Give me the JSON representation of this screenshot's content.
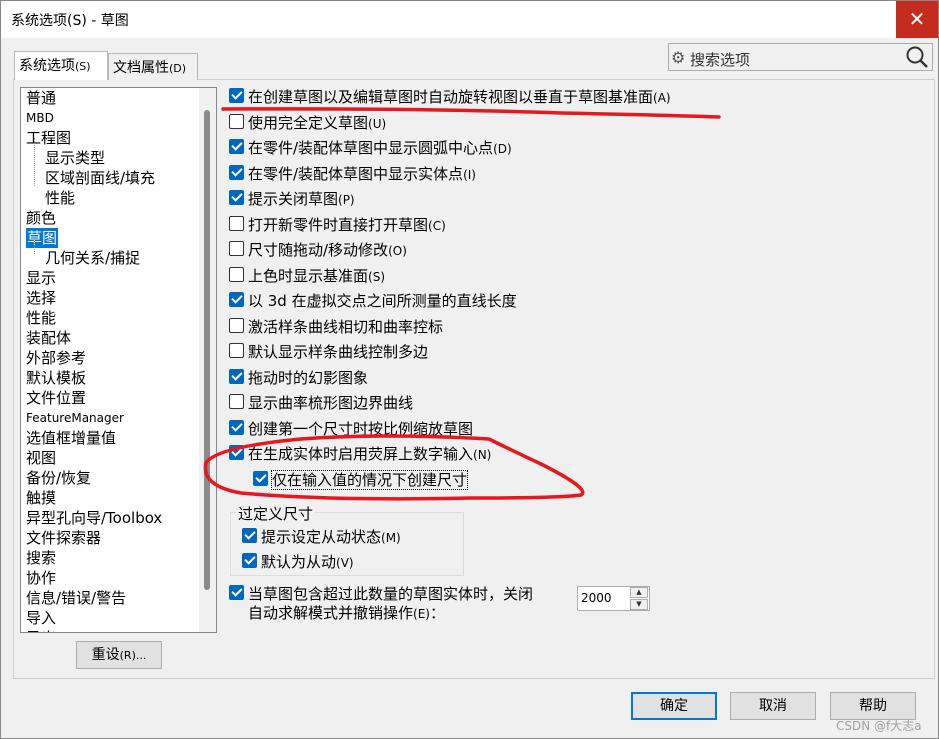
{
  "window": {
    "title": "系统选项(S) - 草图",
    "close": "✕"
  },
  "tabs": [
    {
      "label": "系统选项",
      "hotkey": "(S)"
    },
    {
      "label": "文档属性",
      "hotkey": "(D)"
    }
  ],
  "search": {
    "placeholder": "搜索选项"
  },
  "tree": [
    {
      "label": "普通"
    },
    {
      "label": "MBD"
    },
    {
      "label": "工程图"
    },
    {
      "label": "显示类型"
    },
    {
      "label": "区域剖面线/填充"
    },
    {
      "label": "性能"
    },
    {
      "label": "颜色"
    },
    {
      "label": "草图"
    },
    {
      "label": "几何关系/捕捉"
    },
    {
      "label": "显示"
    },
    {
      "label": "选择"
    },
    {
      "label": "性能"
    },
    {
      "label": "装配体"
    },
    {
      "label": "外部参考"
    },
    {
      "label": "默认模板"
    },
    {
      "label": "文件位置"
    },
    {
      "label": "FeatureManager"
    },
    {
      "label": "选值框增量值"
    },
    {
      "label": "视图"
    },
    {
      "label": "备份/恢复"
    },
    {
      "label": "触摸"
    },
    {
      "label": "异型孔向导/Toolbox"
    },
    {
      "label": "文件探索器"
    },
    {
      "label": "搜索"
    },
    {
      "label": "协作"
    },
    {
      "label": "信息/错误/警告"
    },
    {
      "label": "导入"
    },
    {
      "label": "导出"
    }
  ],
  "options": [
    {
      "label": "在创建草图以及编辑草图时自动旋转视图以垂直于草图基准面",
      "hotkey": "(A)",
      "checked": true
    },
    {
      "label": "使用完全定义草图",
      "hotkey": "(U)",
      "checked": false
    },
    {
      "label": "在零件/装配体草图中显示圆弧中心点",
      "hotkey": "(D)",
      "checked": true
    },
    {
      "label": "在零件/装配体草图中显示实体点",
      "hotkey": "(I)",
      "checked": true
    },
    {
      "label": "提示关闭草图",
      "hotkey": "(P)",
      "checked": true
    },
    {
      "label": "打开新零件时直接打开草图",
      "hotkey": "(C)",
      "checked": false
    },
    {
      "label": "尺寸随拖动/移动修改",
      "hotkey": "(O)",
      "checked": false
    },
    {
      "label": "上色时显示基准面",
      "hotkey": "(S)",
      "checked": false
    },
    {
      "label": "以 3d 在虚拟交点之间所测量的直线长度",
      "hotkey": "",
      "checked": true
    },
    {
      "label": "激活样条曲线相切和曲率控标",
      "hotkey": "",
      "checked": false
    },
    {
      "label": "默认显示样条曲线控制多边",
      "hotkey": "",
      "checked": false
    },
    {
      "label": "拖动时的幻影图象",
      "hotkey": "",
      "checked": true
    },
    {
      "label": "显示曲率梳形图边界曲线",
      "hotkey": "",
      "checked": false
    },
    {
      "label": "创建第一个尺寸时按比例缩放草图",
      "hotkey": "",
      "checked": true
    },
    {
      "label": "在生成实体时启用荧屏上数字输入",
      "hotkey": "(N)",
      "checked": true
    },
    {
      "label": "仅在输入值的情况下创建尺寸",
      "hotkey": "",
      "checked": true
    }
  ],
  "overdefine": {
    "title": "过定义尺寸",
    "items": [
      {
        "label": "提示设定从动状态",
        "hotkey": "(M)",
        "checked": true
      },
      {
        "label": "默认为从动",
        "hotkey": "(V)",
        "checked": true
      }
    ]
  },
  "limit_option": {
    "line1": "当草图包含超过此数量的草图实体时，关闭",
    "line2": "自动求解模式并撤销操作",
    "hotkey": "(E)",
    "suffix": "：",
    "checked": true,
    "value": "2000"
  },
  "buttons": {
    "reset": "重设",
    "reset_hotkey": "(R)...",
    "ok": "确定",
    "cancel": "取消",
    "help": "帮助"
  },
  "watermark": "CSDN @f大志a",
  "colors": {
    "accent": "#0078d7",
    "annotation": "#e8171e",
    "close": "#c42b1c"
  }
}
